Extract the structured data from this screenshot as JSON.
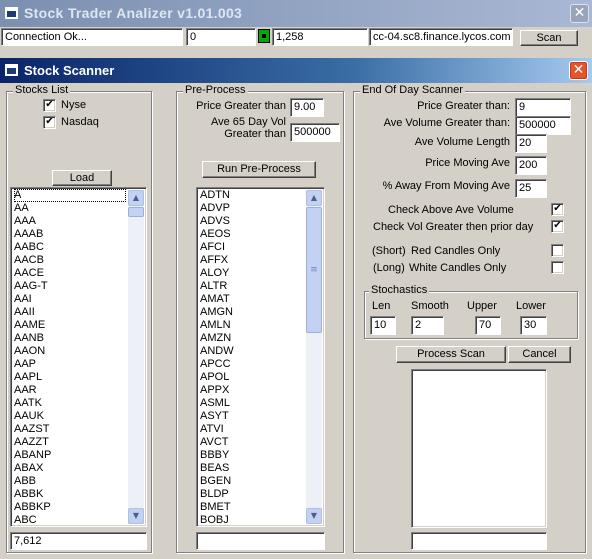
{
  "outer_window": {
    "title": "Stock Trader Analizer v1.01.003",
    "close_glyph": "✕"
  },
  "status_bar": {
    "connection": "Connection Ok...",
    "counter": "0",
    "value": "1,258",
    "server": "cc-04.sc8.finance.lycos.com",
    "scan_label": "Scan",
    "led_color": "#00aa00"
  },
  "scanner_window": {
    "title": "Stock Scanner",
    "close_glyph": "✕",
    "title_color": "#0a246a"
  },
  "stocks_list": {
    "group_label": "Stocks List",
    "nyse_label": "Nyse",
    "nyse_checked": true,
    "nasdaq_label": "Nasdaq",
    "nasdaq_checked": true,
    "load_label": "Load",
    "items": [
      "A",
      "AA",
      "AAA",
      "AAAB",
      "AABC",
      "AACB",
      "AACE",
      "AAG-T",
      "AAI",
      "AAII",
      "AAME",
      "AANB",
      "AAON",
      "AAP",
      "AAPL",
      "AAR",
      "AATK",
      "AAUK",
      "AAZST",
      "AAZZT",
      "ABANP",
      "ABAX",
      "ABB",
      "ABBK",
      "ABBKP",
      "ABC"
    ],
    "count": "7,612"
  },
  "pre_process": {
    "group_label": "Pre-Process",
    "price_label": "Price Greater than",
    "price_value": "9.00",
    "vol_label_1": "Ave 65 Day Vol",
    "vol_label_2": "Greater than",
    "vol_value": "500000",
    "run_label": "Run Pre-Process",
    "items": [
      "ADTN",
      "ADVP",
      "ADVS",
      "AEOS",
      "AFCI",
      "AFFX",
      "ALOY",
      "ALTR",
      "AMAT",
      "AMGN",
      "AMLN",
      "AMZN",
      "ANDW",
      "APCC",
      "APOL",
      "APPX",
      "ASML",
      "ASYT",
      "ATVI",
      "AVCT",
      "BBBY",
      "BEAS",
      "BGEN",
      "BLDP",
      "BMET",
      "BOBJ"
    ],
    "count": ""
  },
  "eod_scanner": {
    "group_label": "End Of Day Scanner",
    "fields": [
      {
        "label": "Price Greater than:",
        "value": "9"
      },
      {
        "label": "Ave Volume Greater than:",
        "value": "500000"
      },
      {
        "label": "Ave Volume Length",
        "value": "20"
      },
      {
        "label": "Price Moving Ave",
        "value": "200"
      },
      {
        "label": "% Away From Moving Ave",
        "value": "25"
      }
    ],
    "checks": [
      {
        "prefix": "",
        "label": "Check Above Ave Volume",
        "checked": true
      },
      {
        "prefix": "",
        "label": "Check Vol Greater then prior day",
        "checked": true
      },
      {
        "prefix": "(Short)",
        "label": "Red Candles Only",
        "checked": false
      },
      {
        "prefix": "(Long)",
        "label": "White Candles Only",
        "checked": false
      }
    ],
    "stochastics": {
      "group_label": "Stochastics",
      "len_label": "Len",
      "len_value": "10",
      "smooth_label": "Smooth",
      "smooth_value": "2",
      "upper_label": "Upper",
      "upper_value": "70",
      "lower_label": "Lower",
      "lower_value": "30"
    },
    "process_label": "Process Scan",
    "cancel_label": "Cancel",
    "result_text": ""
  }
}
